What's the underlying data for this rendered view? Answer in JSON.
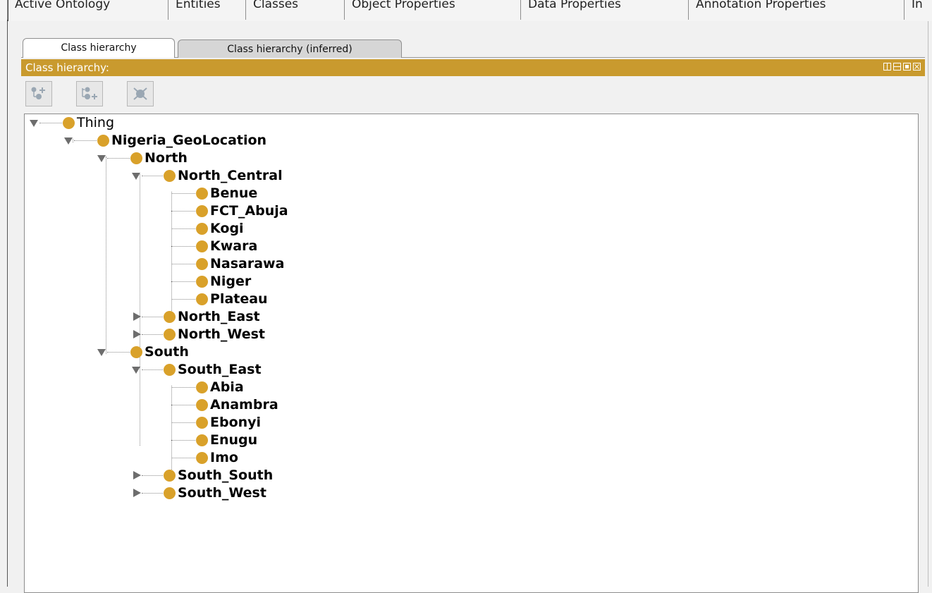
{
  "top_tabs": [
    "Active Ontology",
    "Entities",
    "Classes",
    "Object Properties",
    "Data Properties",
    "Annotation Properties",
    "In"
  ],
  "sub_tabs": [
    "Class hierarchy",
    "Class hierarchy (inferred)"
  ],
  "panel": {
    "title": "Class hierarchy:",
    "accent_color": "#c99a2e",
    "window_controls": [
      "split-vertical-icon",
      "split-horizontal-icon",
      "maximize-icon",
      "close-icon"
    ]
  },
  "toolbar": {
    "buttons": [
      "add-subclass-icon",
      "add-sibling-class-icon",
      "delete-class-icon"
    ]
  },
  "tree": {
    "node_color": "#d9a12a",
    "nodes": [
      {
        "label": "Thing",
        "expanded": true
      },
      {
        "label": "Nigeria_GeoLocation",
        "expanded": true
      },
      {
        "label": "North",
        "expanded": true
      },
      {
        "label": "North_Central",
        "expanded": true
      },
      {
        "label": "Benue"
      },
      {
        "label": "FCT_Abuja"
      },
      {
        "label": "Kogi"
      },
      {
        "label": "Kwara"
      },
      {
        "label": "Nasarawa"
      },
      {
        "label": "Niger"
      },
      {
        "label": "Plateau"
      },
      {
        "label": "North_East",
        "expanded": false
      },
      {
        "label": "North_West",
        "expanded": false
      },
      {
        "label": "South",
        "expanded": true
      },
      {
        "label": "South_East",
        "expanded": true
      },
      {
        "label": "Abia"
      },
      {
        "label": "Anambra"
      },
      {
        "label": "Ebonyi"
      },
      {
        "label": "Enugu"
      },
      {
        "label": "Imo"
      },
      {
        "label": "South_South",
        "expanded": false
      },
      {
        "label": "South_West",
        "expanded": false
      }
    ]
  }
}
